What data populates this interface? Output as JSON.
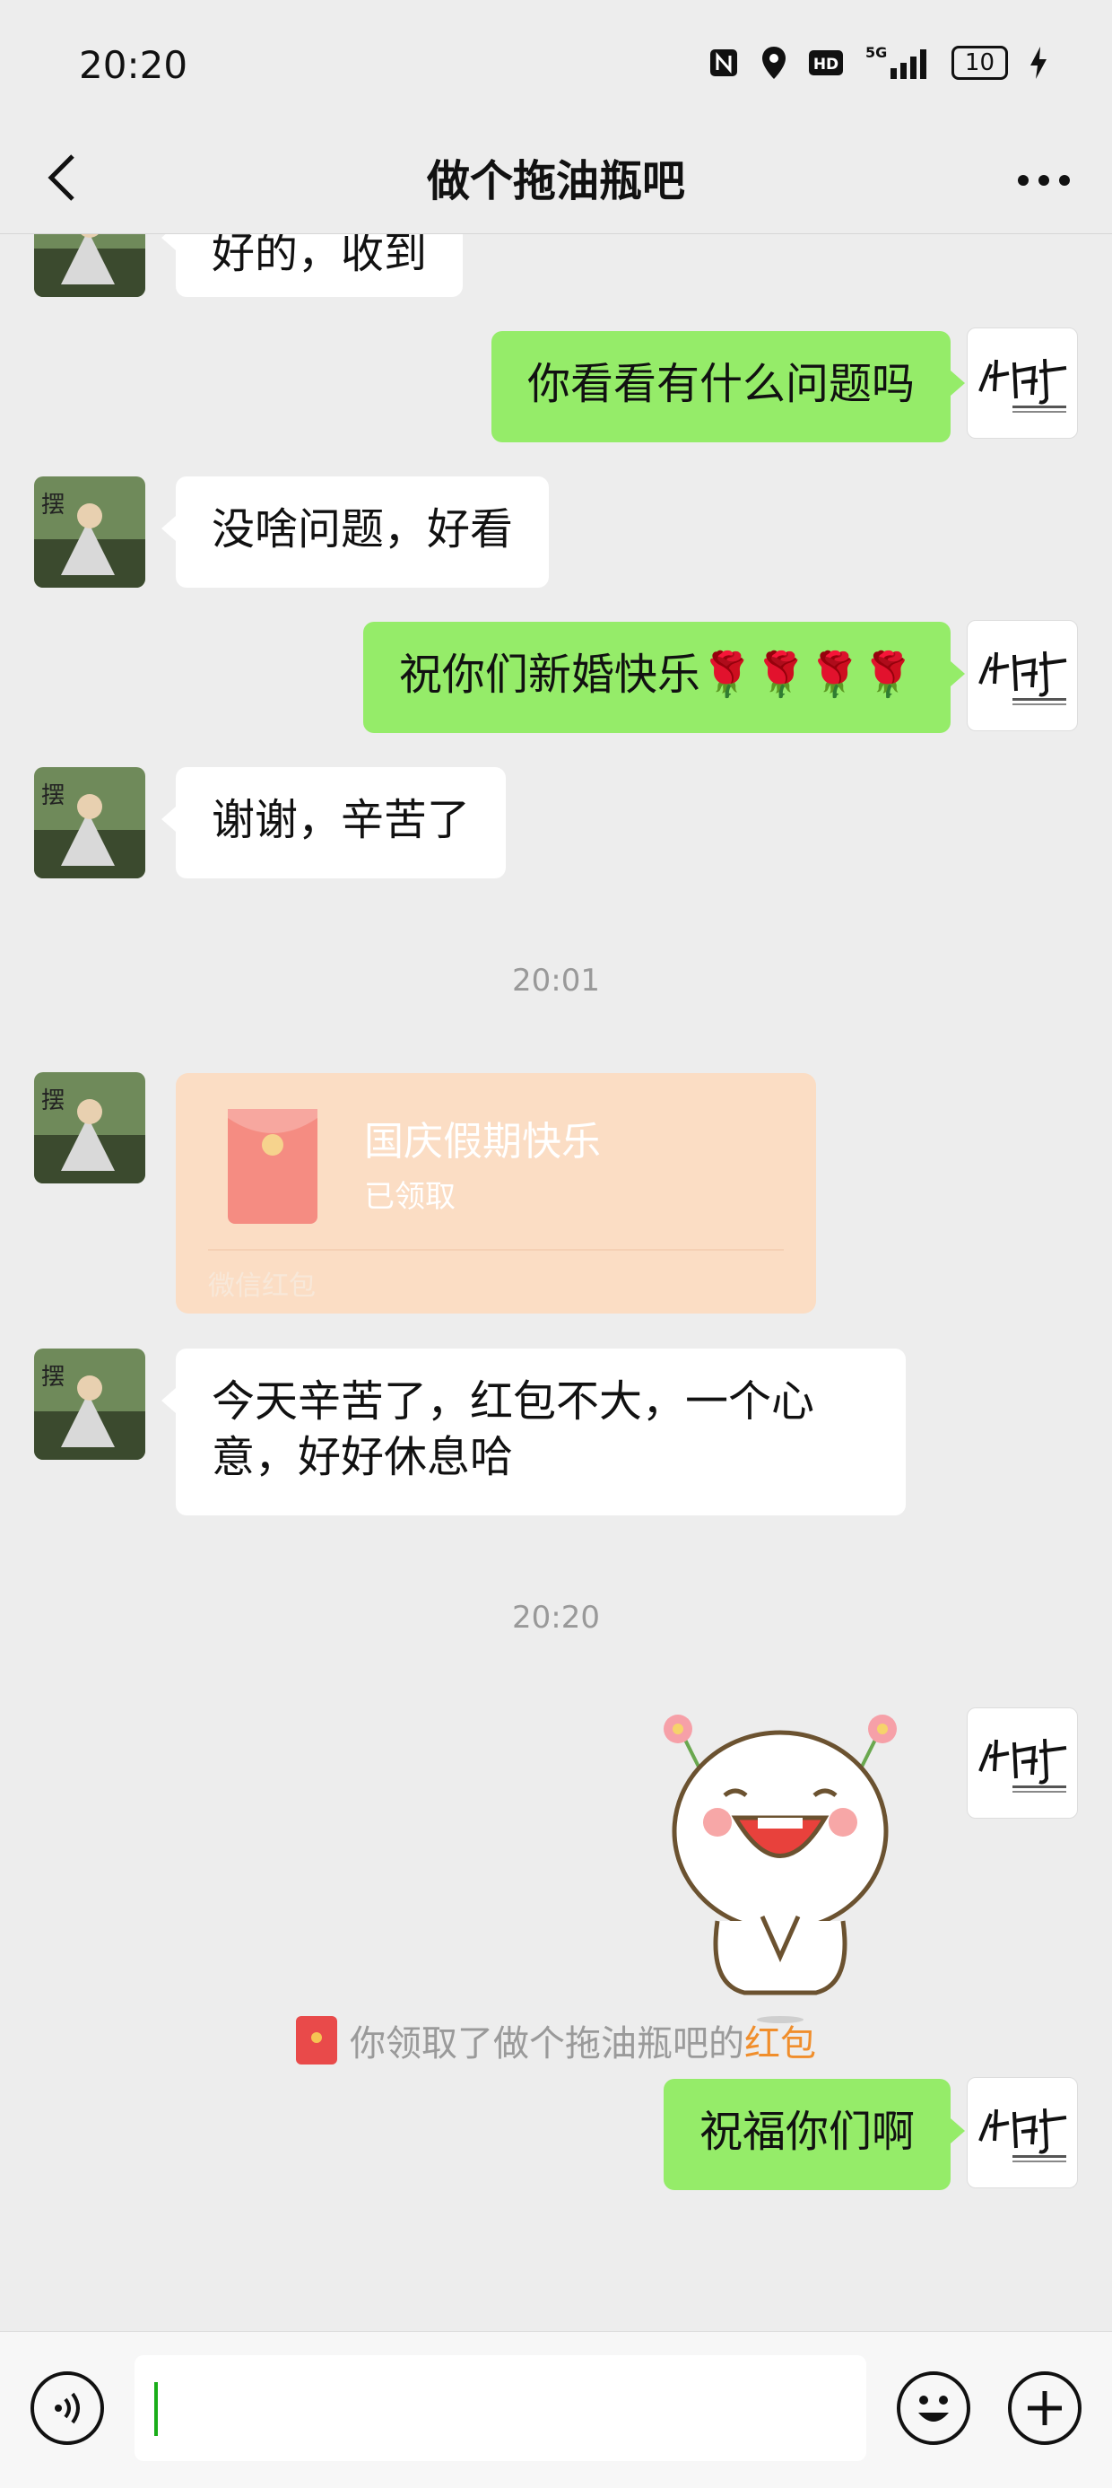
{
  "status_bar": {
    "time": "20:20",
    "network": "5G",
    "battery": "10",
    "hd": "HD",
    "icons": [
      "nfc-icon",
      "location-icon",
      "hd-icon",
      "signal-icon",
      "battery-icon",
      "charging-icon"
    ]
  },
  "header": {
    "title": "做个拖油瓶吧"
  },
  "messages": [
    {
      "side": "in",
      "text": "好的，收到"
    },
    {
      "side": "out",
      "text": "你看看有什么问题吗"
    },
    {
      "side": "in",
      "text": "没啥问题，好看"
    },
    {
      "side": "out",
      "text": "祝你们新婚快乐🌹🌹🌹🌹"
    },
    {
      "side": "in",
      "text": "谢谢，辛苦了"
    },
    {
      "side": "in",
      "text": "今天辛苦了，红包不大，一个心意，好好休息哈"
    },
    {
      "side": "out",
      "text": "祝福你们啊"
    }
  ],
  "timestamps": [
    "20:01",
    "20:20"
  ],
  "red_packet": {
    "title": "国庆假期快乐",
    "status": "已领取",
    "footer": "微信红包"
  },
  "system_notice": {
    "prefix": "你领取了做个拖油瓶吧的",
    "link": "红包"
  },
  "input": {
    "value": ""
  },
  "colors": {
    "out_bubble": "#95ec69",
    "in_bubble": "#ffffff",
    "background": "#ededed",
    "red_packet": "#fbddc4",
    "link": "#f08e2c"
  }
}
